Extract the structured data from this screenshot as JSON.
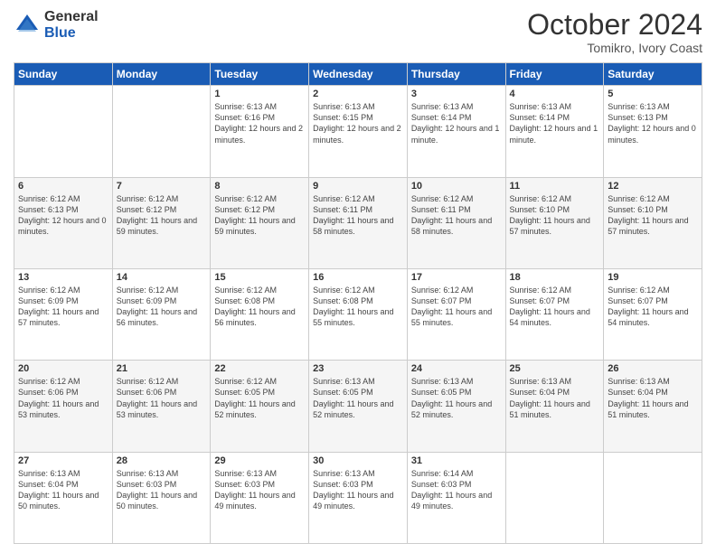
{
  "header": {
    "logo_general": "General",
    "logo_blue": "Blue",
    "month_title": "October 2024",
    "subtitle": "Tomikro, Ivory Coast"
  },
  "calendar": {
    "headers": [
      "Sunday",
      "Monday",
      "Tuesday",
      "Wednesday",
      "Thursday",
      "Friday",
      "Saturday"
    ],
    "weeks": [
      [
        {
          "day": "",
          "info": ""
        },
        {
          "day": "",
          "info": ""
        },
        {
          "day": "1",
          "info": "Sunrise: 6:13 AM\nSunset: 6:16 PM\nDaylight: 12 hours\nand 2 minutes."
        },
        {
          "day": "2",
          "info": "Sunrise: 6:13 AM\nSunset: 6:15 PM\nDaylight: 12 hours\nand 2 minutes."
        },
        {
          "day": "3",
          "info": "Sunrise: 6:13 AM\nSunset: 6:14 PM\nDaylight: 12 hours\nand 1 minute."
        },
        {
          "day": "4",
          "info": "Sunrise: 6:13 AM\nSunset: 6:14 PM\nDaylight: 12 hours\nand 1 minute."
        },
        {
          "day": "5",
          "info": "Sunrise: 6:13 AM\nSunset: 6:13 PM\nDaylight: 12 hours\nand 0 minutes."
        }
      ],
      [
        {
          "day": "6",
          "info": "Sunrise: 6:12 AM\nSunset: 6:13 PM\nDaylight: 12 hours\nand 0 minutes."
        },
        {
          "day": "7",
          "info": "Sunrise: 6:12 AM\nSunset: 6:12 PM\nDaylight: 11 hours\nand 59 minutes."
        },
        {
          "day": "8",
          "info": "Sunrise: 6:12 AM\nSunset: 6:12 PM\nDaylight: 11 hours\nand 59 minutes."
        },
        {
          "day": "9",
          "info": "Sunrise: 6:12 AM\nSunset: 6:11 PM\nDaylight: 11 hours\nand 58 minutes."
        },
        {
          "day": "10",
          "info": "Sunrise: 6:12 AM\nSunset: 6:11 PM\nDaylight: 11 hours\nand 58 minutes."
        },
        {
          "day": "11",
          "info": "Sunrise: 6:12 AM\nSunset: 6:10 PM\nDaylight: 11 hours\nand 57 minutes."
        },
        {
          "day": "12",
          "info": "Sunrise: 6:12 AM\nSunset: 6:10 PM\nDaylight: 11 hours\nand 57 minutes."
        }
      ],
      [
        {
          "day": "13",
          "info": "Sunrise: 6:12 AM\nSunset: 6:09 PM\nDaylight: 11 hours\nand 57 minutes."
        },
        {
          "day": "14",
          "info": "Sunrise: 6:12 AM\nSunset: 6:09 PM\nDaylight: 11 hours\nand 56 minutes."
        },
        {
          "day": "15",
          "info": "Sunrise: 6:12 AM\nSunset: 6:08 PM\nDaylight: 11 hours\nand 56 minutes."
        },
        {
          "day": "16",
          "info": "Sunrise: 6:12 AM\nSunset: 6:08 PM\nDaylight: 11 hours\nand 55 minutes."
        },
        {
          "day": "17",
          "info": "Sunrise: 6:12 AM\nSunset: 6:07 PM\nDaylight: 11 hours\nand 55 minutes."
        },
        {
          "day": "18",
          "info": "Sunrise: 6:12 AM\nSunset: 6:07 PM\nDaylight: 11 hours\nand 54 minutes."
        },
        {
          "day": "19",
          "info": "Sunrise: 6:12 AM\nSunset: 6:07 PM\nDaylight: 11 hours\nand 54 minutes."
        }
      ],
      [
        {
          "day": "20",
          "info": "Sunrise: 6:12 AM\nSunset: 6:06 PM\nDaylight: 11 hours\nand 53 minutes."
        },
        {
          "day": "21",
          "info": "Sunrise: 6:12 AM\nSunset: 6:06 PM\nDaylight: 11 hours\nand 53 minutes."
        },
        {
          "day": "22",
          "info": "Sunrise: 6:12 AM\nSunset: 6:05 PM\nDaylight: 11 hours\nand 52 minutes."
        },
        {
          "day": "23",
          "info": "Sunrise: 6:13 AM\nSunset: 6:05 PM\nDaylight: 11 hours\nand 52 minutes."
        },
        {
          "day": "24",
          "info": "Sunrise: 6:13 AM\nSunset: 6:05 PM\nDaylight: 11 hours\nand 52 minutes."
        },
        {
          "day": "25",
          "info": "Sunrise: 6:13 AM\nSunset: 6:04 PM\nDaylight: 11 hours\nand 51 minutes."
        },
        {
          "day": "26",
          "info": "Sunrise: 6:13 AM\nSunset: 6:04 PM\nDaylight: 11 hours\nand 51 minutes."
        }
      ],
      [
        {
          "day": "27",
          "info": "Sunrise: 6:13 AM\nSunset: 6:04 PM\nDaylight: 11 hours\nand 50 minutes."
        },
        {
          "day": "28",
          "info": "Sunrise: 6:13 AM\nSunset: 6:03 PM\nDaylight: 11 hours\nand 50 minutes."
        },
        {
          "day": "29",
          "info": "Sunrise: 6:13 AM\nSunset: 6:03 PM\nDaylight: 11 hours\nand 49 minutes."
        },
        {
          "day": "30",
          "info": "Sunrise: 6:13 AM\nSunset: 6:03 PM\nDaylight: 11 hours\nand 49 minutes."
        },
        {
          "day": "31",
          "info": "Sunrise: 6:14 AM\nSunset: 6:03 PM\nDaylight: 11 hours\nand 49 minutes."
        },
        {
          "day": "",
          "info": ""
        },
        {
          "day": "",
          "info": ""
        }
      ]
    ]
  }
}
